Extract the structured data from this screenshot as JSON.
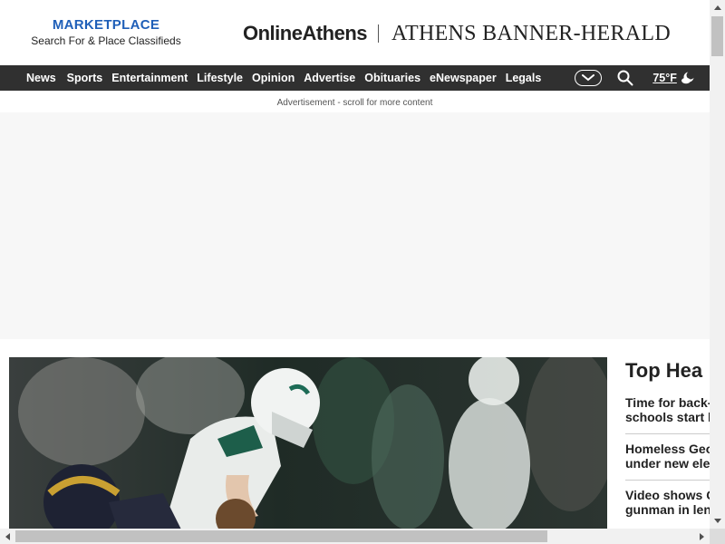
{
  "header": {
    "marketplace_title": "MARKETPLACE",
    "marketplace_subtitle": "Search For & Place Classifieds",
    "brand_online": "OnlineAthens",
    "brand_abh": "ATHENS BANNER-HERALD"
  },
  "nav": {
    "items": [
      "News",
      "Sports",
      "Entertainment",
      "Lifestyle",
      "Opinion",
      "Advertise",
      "Obituaries",
      "eNewspaper",
      "Legals"
    ],
    "more_icon": "chevron-down-icon",
    "search_icon": "search-icon",
    "weather_temp": "75°F",
    "weather_icon": "partly-cloudy-night-icon"
  },
  "ad": {
    "label": "Advertisement - scroll for more content"
  },
  "hero": {
    "image_icon": "football-game-photo"
  },
  "top_headlines": {
    "title": "Top Hea",
    "items": [
      {
        "line1": "Time for back-",
        "line2": "schools start l"
      },
      {
        "line1": "Homeless Geo",
        "line2": "under new ele"
      },
      {
        "line1": "Video shows C",
        "line2": "gunman in len"
      }
    ]
  },
  "colors": {
    "marketplace_blue": "#1f5fb8",
    "nav_bg": "#303030",
    "ad_bg": "#f7f7f7"
  }
}
